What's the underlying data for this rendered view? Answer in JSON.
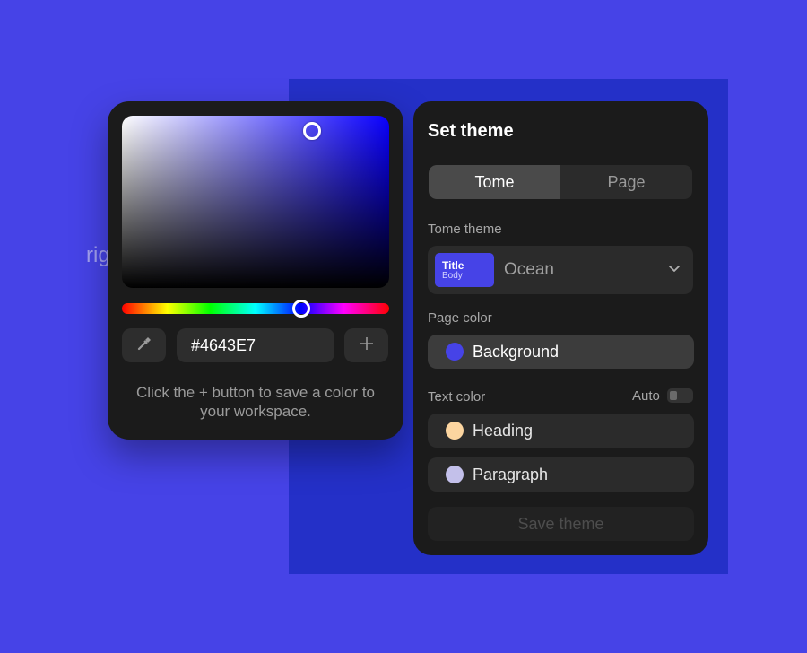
{
  "background_text": "rig",
  "color_picker": {
    "hex_value": "#4643E7",
    "saturation_handle": {
      "saturation": 0.71,
      "brightness": 0.91
    },
    "hue_position": 0.67,
    "hint": "Click the + button to save a color to your workspace.",
    "icons": {
      "eyedropper": "eyedropper-icon",
      "add": "plus-icon"
    }
  },
  "theme_panel": {
    "title": "Set theme",
    "tabs": [
      {
        "label": "Tome",
        "active": true
      },
      {
        "label": "Page",
        "active": false
      }
    ],
    "tome_theme": {
      "label": "Tome theme",
      "swatch_title": "Title",
      "swatch_body": "Body",
      "selected": "Ocean"
    },
    "page_color": {
      "label": "Page color",
      "item": {
        "label": "Background",
        "color": "#4643e7"
      }
    },
    "text_color": {
      "label": "Text color",
      "auto_label": "Auto",
      "auto_enabled": false,
      "items": [
        {
          "label": "Heading",
          "color": "#fcd5a0"
        },
        {
          "label": "Paragraph",
          "color": "#c3c0ea"
        }
      ]
    },
    "save_label": "Save theme"
  },
  "colors": {
    "accent": "#4643e7",
    "panel": "#1b1b1b",
    "backdrop": "#2430c8"
  }
}
